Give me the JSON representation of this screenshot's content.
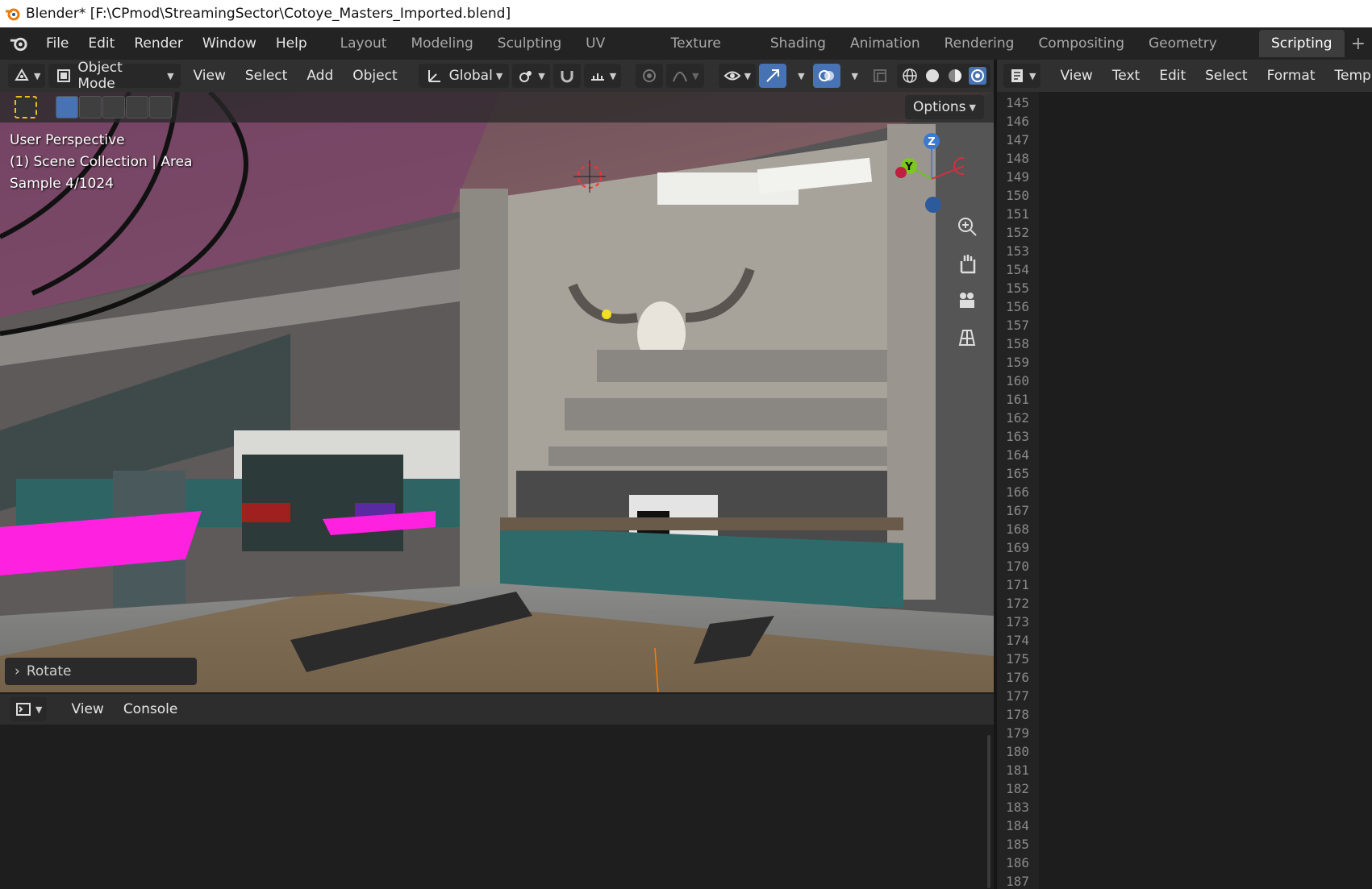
{
  "window": {
    "title": "Blender* [F:\\CPmod\\StreamingSector\\Cotoye_Masters_Imported.blend]"
  },
  "menu": [
    "File",
    "Edit",
    "Render",
    "Window",
    "Help"
  ],
  "workspaces": [
    "Layout",
    "Modeling",
    "Sculpting",
    "UV Editing",
    "Texture Paint",
    "Shading",
    "Animation",
    "Rendering",
    "Compositing",
    "Geometry Nodes",
    "Scripting"
  ],
  "active_workspace": "Scripting",
  "viewport_header": {
    "mode": "Object Mode",
    "menus": [
      "View",
      "Select",
      "Add",
      "Object"
    ],
    "orientation": "Global"
  },
  "viewport": {
    "options_label": "Options",
    "overlay_text": [
      "User Perspective",
      "(1) Scene Collection | Area",
      "Sample 4/1024"
    ],
    "gizmo_axes": {
      "z": "Z",
      "y": "Y"
    },
    "last_op_label": "Rotate"
  },
  "console_header": {
    "menus": [
      "View",
      "Console"
    ]
  },
  "text_editor": {
    "menus": [
      "View",
      "Text",
      "Edit",
      "Select",
      "Format",
      "Templat"
    ],
    "line_numbers": [
      "145",
      "146",
      "147",
      "148",
      "149",
      "150",
      "151",
      "152",
      "153",
      "154",
      "155",
      "156",
      "157",
      "158",
      "159",
      "160",
      "161",
      "162",
      "163",
      "164",
      "165",
      "166",
      "167",
      "168",
      "169",
      "170",
      "171",
      "172",
      "173",
      "174",
      "175",
      "176",
      "177",
      "178",
      "179",
      "180",
      "181",
      "182",
      "183",
      "184",
      "185",
      "186",
      "187"
    ]
  },
  "colors": {
    "accent": "#4772b3",
    "keyword": "#ff4d6a",
    "string": "#e8c27a",
    "comment": "#a0a0a0",
    "number": "#c79bff"
  }
}
